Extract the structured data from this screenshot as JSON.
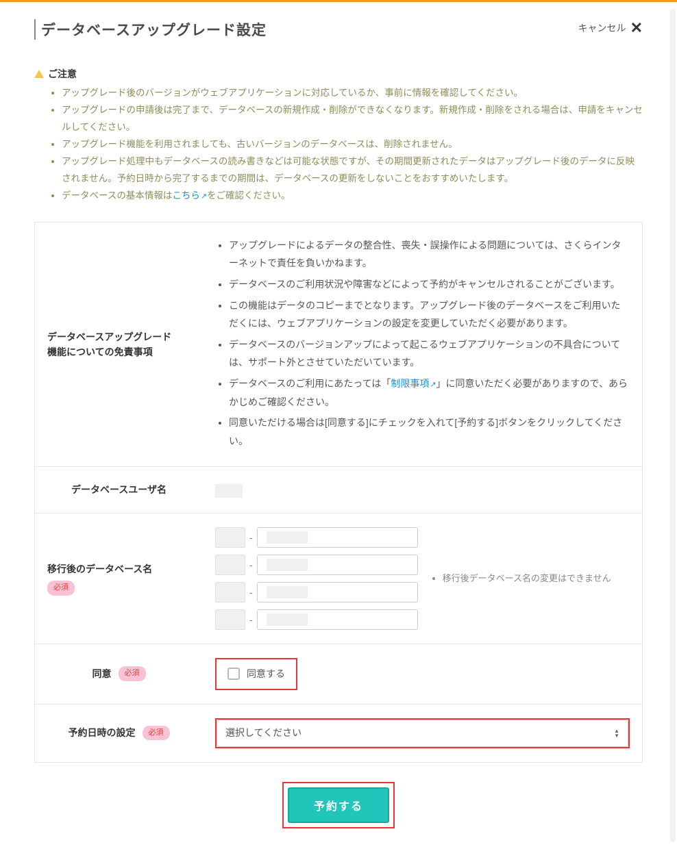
{
  "header": {
    "title": "データベースアップグレード設定",
    "cancel": "キャンセル"
  },
  "caution": {
    "title": "ご注意",
    "items": [
      "アップグレード後のバージョンがウェブアプリケーションに対応しているか、事前に情報を確認してください。",
      "アップグレードの申請後は完了まで、データベースの新規作成・削除ができなくなります。新規作成・削除をされる場合は、申請をキャンセルしてください。",
      "アップグレード機能を利用されましても、古いバージョンのデータベースは、削除されません。",
      "アップグレード処理中もデータベースの読み書きなどは可能な状態ですが、その期間更新されたデータはアップグレード後のデータに反映されません。予約日時から完了するまでの期間は、データベースの更新をしないことをおすすめいたします。"
    ],
    "last_prefix": "データベースの基本情報は",
    "last_link": "こちら",
    "last_suffix": "をご確認ください。"
  },
  "disclaimer": {
    "label_line1": "データベースアップグレード",
    "label_line2": "機能についての免責事項",
    "items_a": [
      "アップグレードによるデータの整合性、喪失・誤操作による問題については、さくらインターネットで責任を負いかねます。",
      "データベースのご利用状況や障害などによって予約がキャンセルされることがございます。",
      "この機能はデータのコピーまでとなります。アップグレード後のデータベースをご利用いただくには、ウェブアプリケーションの設定を変更していただく必要があります。",
      "データベースのバージョンアップによって起こるウェブアプリケーションの不具合については、サポート外とさせていただいています。"
    ],
    "item_link_prefix": "データベースのご利用にあたっては「",
    "item_link": "制限事項",
    "item_link_suffix": "」に同意いただく必要がありますので、あらかじめご確認ください。",
    "item_last": "同意いただける場合は[同意する]にチェックを入れて[予約する]ボタンをクリックしてください。"
  },
  "rows": {
    "db_user_label": "データベースユーザ名",
    "db_name_label": "移行後のデータベース名",
    "db_name_note": "移行後データベース名の変更はできません",
    "consent_label": "同意",
    "consent_text": "同意する",
    "schedule_label": "予約日時の設定",
    "required_badge": "必須"
  },
  "select": {
    "placeholder": "選択してください"
  },
  "submit": {
    "label": "予約する"
  }
}
